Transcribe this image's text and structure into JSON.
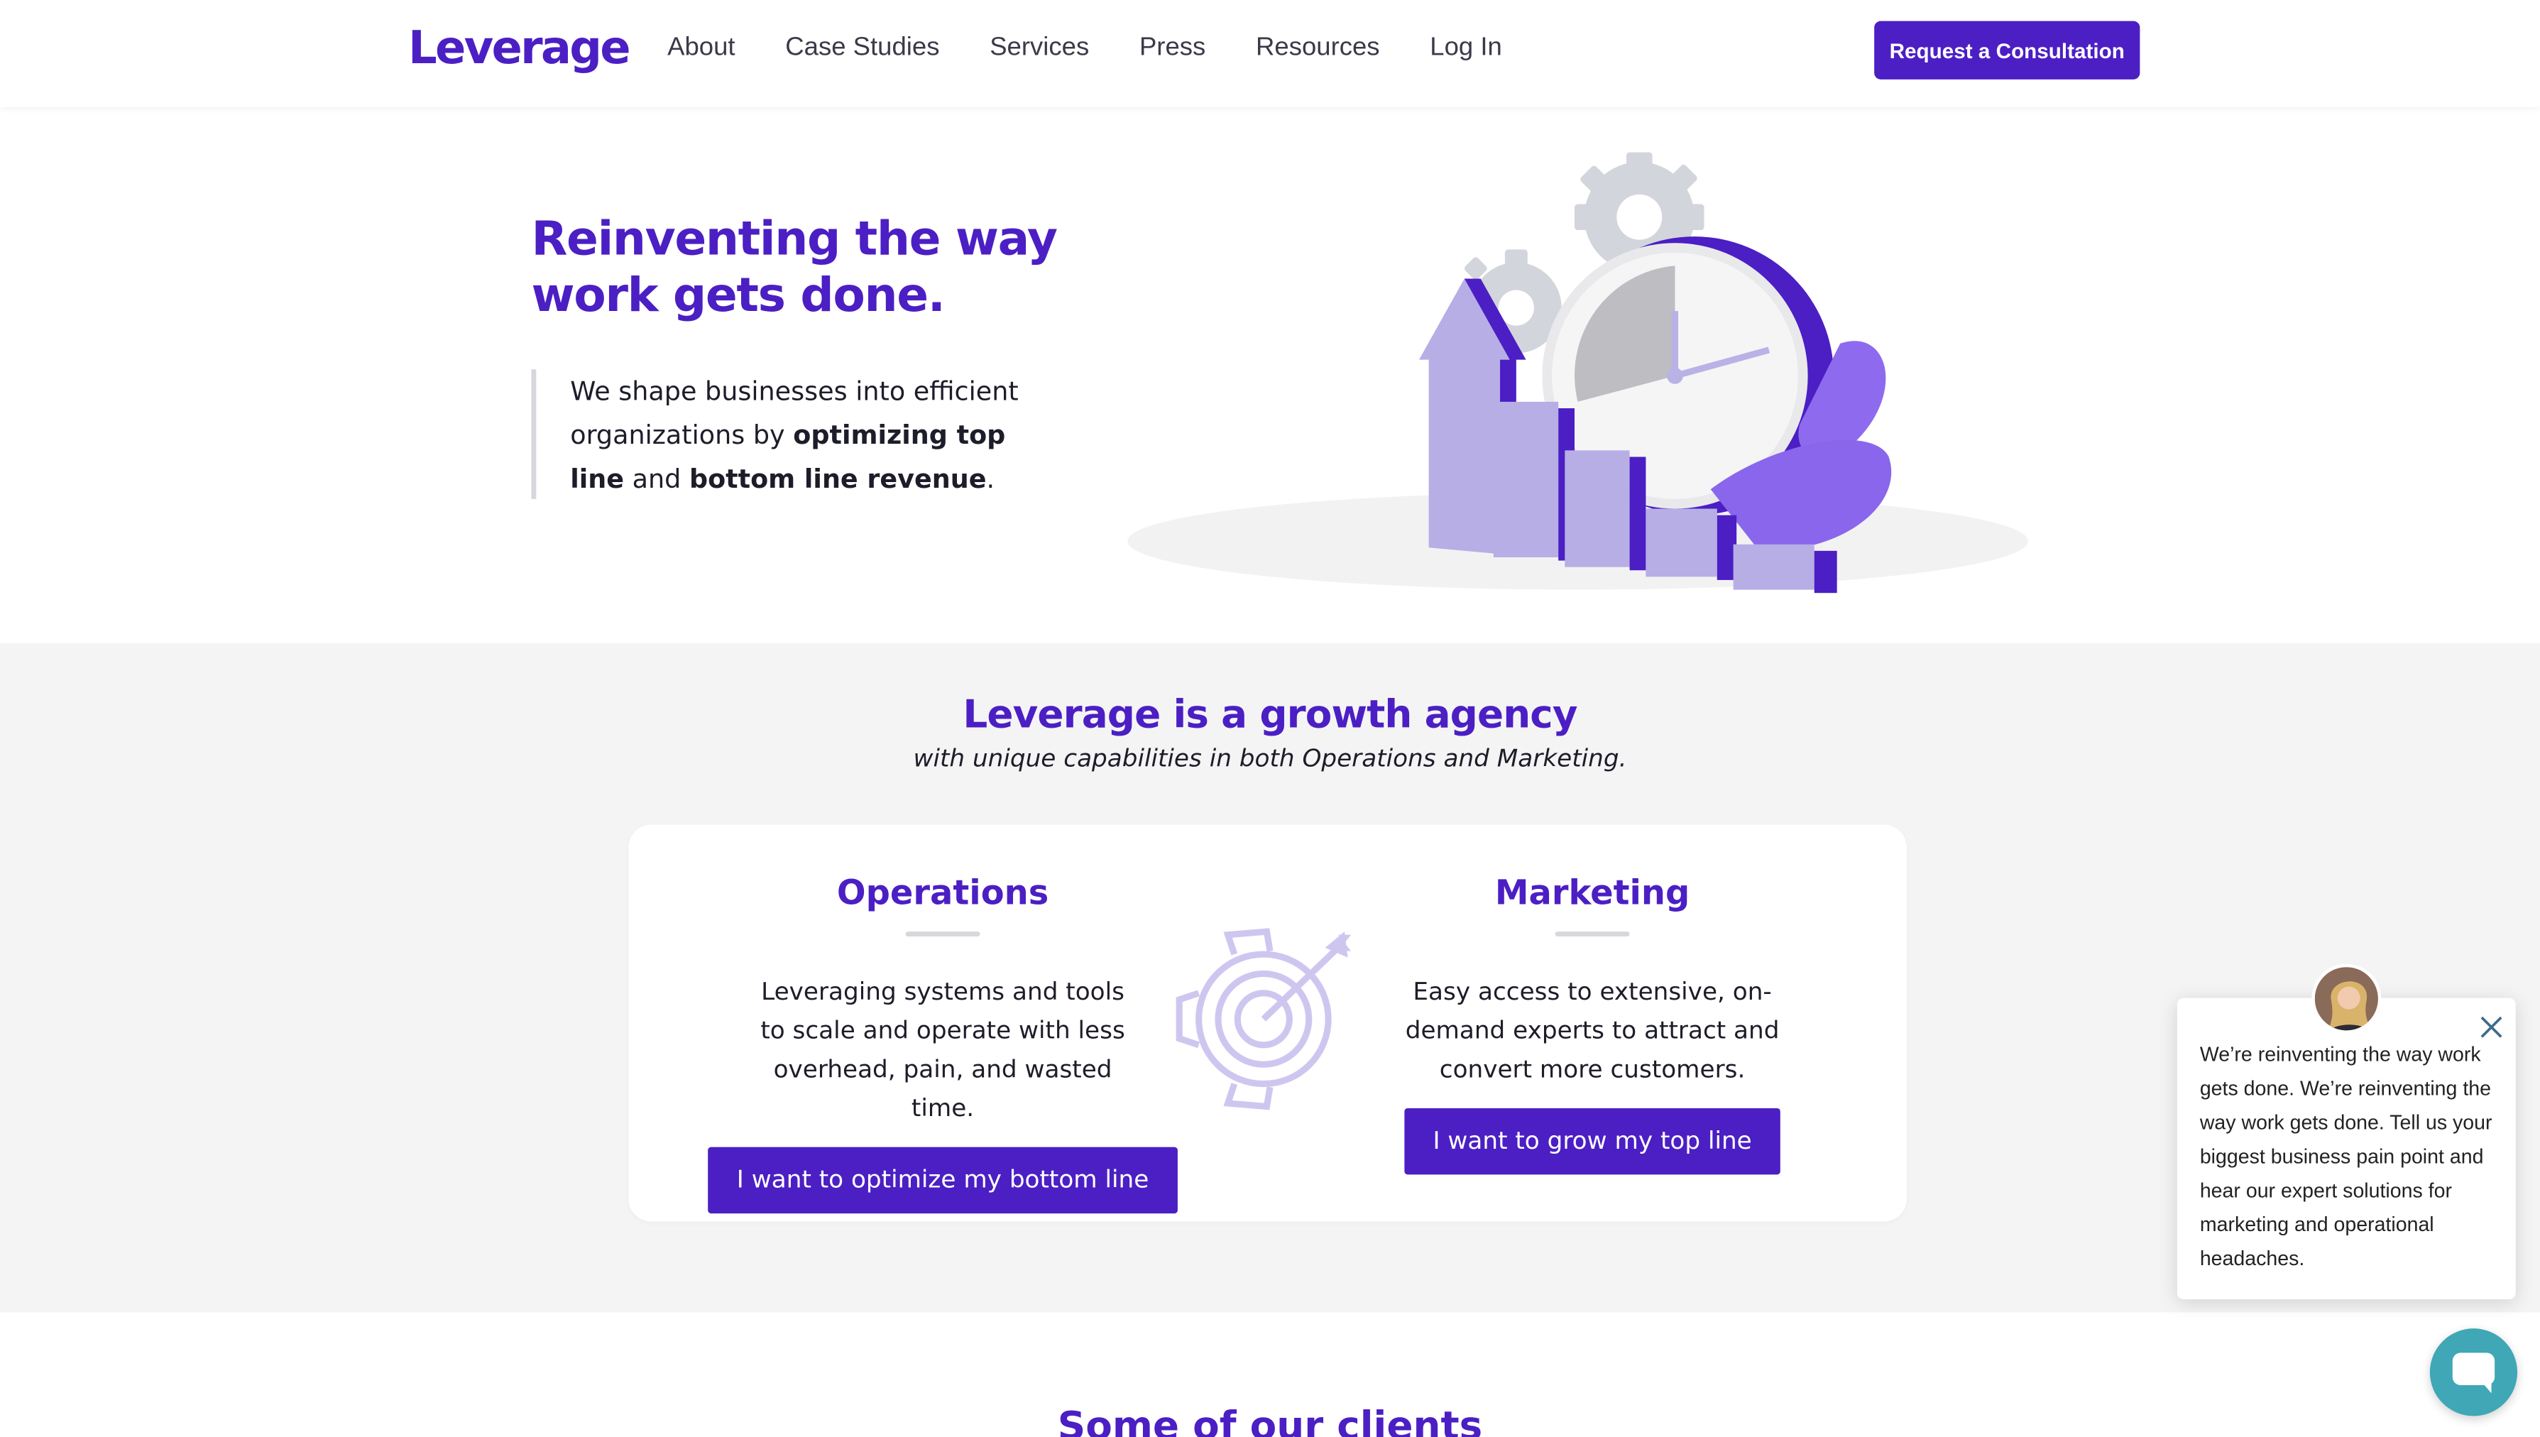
{
  "header": {
    "logo": "Leverage",
    "nav": [
      "About",
      "Case Studies",
      "Services",
      "Press",
      "Resources",
      "Log In"
    ],
    "cta": "Request a Consultation"
  },
  "hero": {
    "title_line1": "Reinventing the way",
    "title_line2": "work gets done.",
    "text_part1": "We shape businesses into efficient organizations by ",
    "text_bold1": "optimizing top line",
    "text_part2": " and ",
    "text_bold2": "bottom line revenue",
    "text_part3": ".",
    "illustration_icon": "growth-clock-chart-illustration"
  },
  "growth": {
    "title": "Leverage is a growth agency",
    "subtitle": "with unique capabilities in both Operations and Marketing.",
    "operations": {
      "title": "Operations",
      "desc": "Leveraging systems and tools to scale and operate with less overhead, pain, and wasted time.",
      "button": "I want to optimize my bottom line"
    },
    "marketing": {
      "title": "Marketing",
      "desc": "Easy access to extensive, on-demand experts to attract and convert more customers.",
      "button": "I want to grow my top line"
    },
    "center_icon": "gear-target-icon"
  },
  "clients": {
    "title": "Some of our clients"
  },
  "chat": {
    "message": "We’re reinventing the way work gets done. We’re reinventing the way work gets done. Tell us your biggest business pain point and hear our expert solutions for marketing and operational headaches.",
    "close_icon": "close-icon",
    "launcher_icon": "chat-bubble-icon"
  },
  "colors": {
    "brand": "#4b1fc4",
    "section_bg": "#f4f4f5",
    "chat_launcher": "#3fa7b6"
  }
}
